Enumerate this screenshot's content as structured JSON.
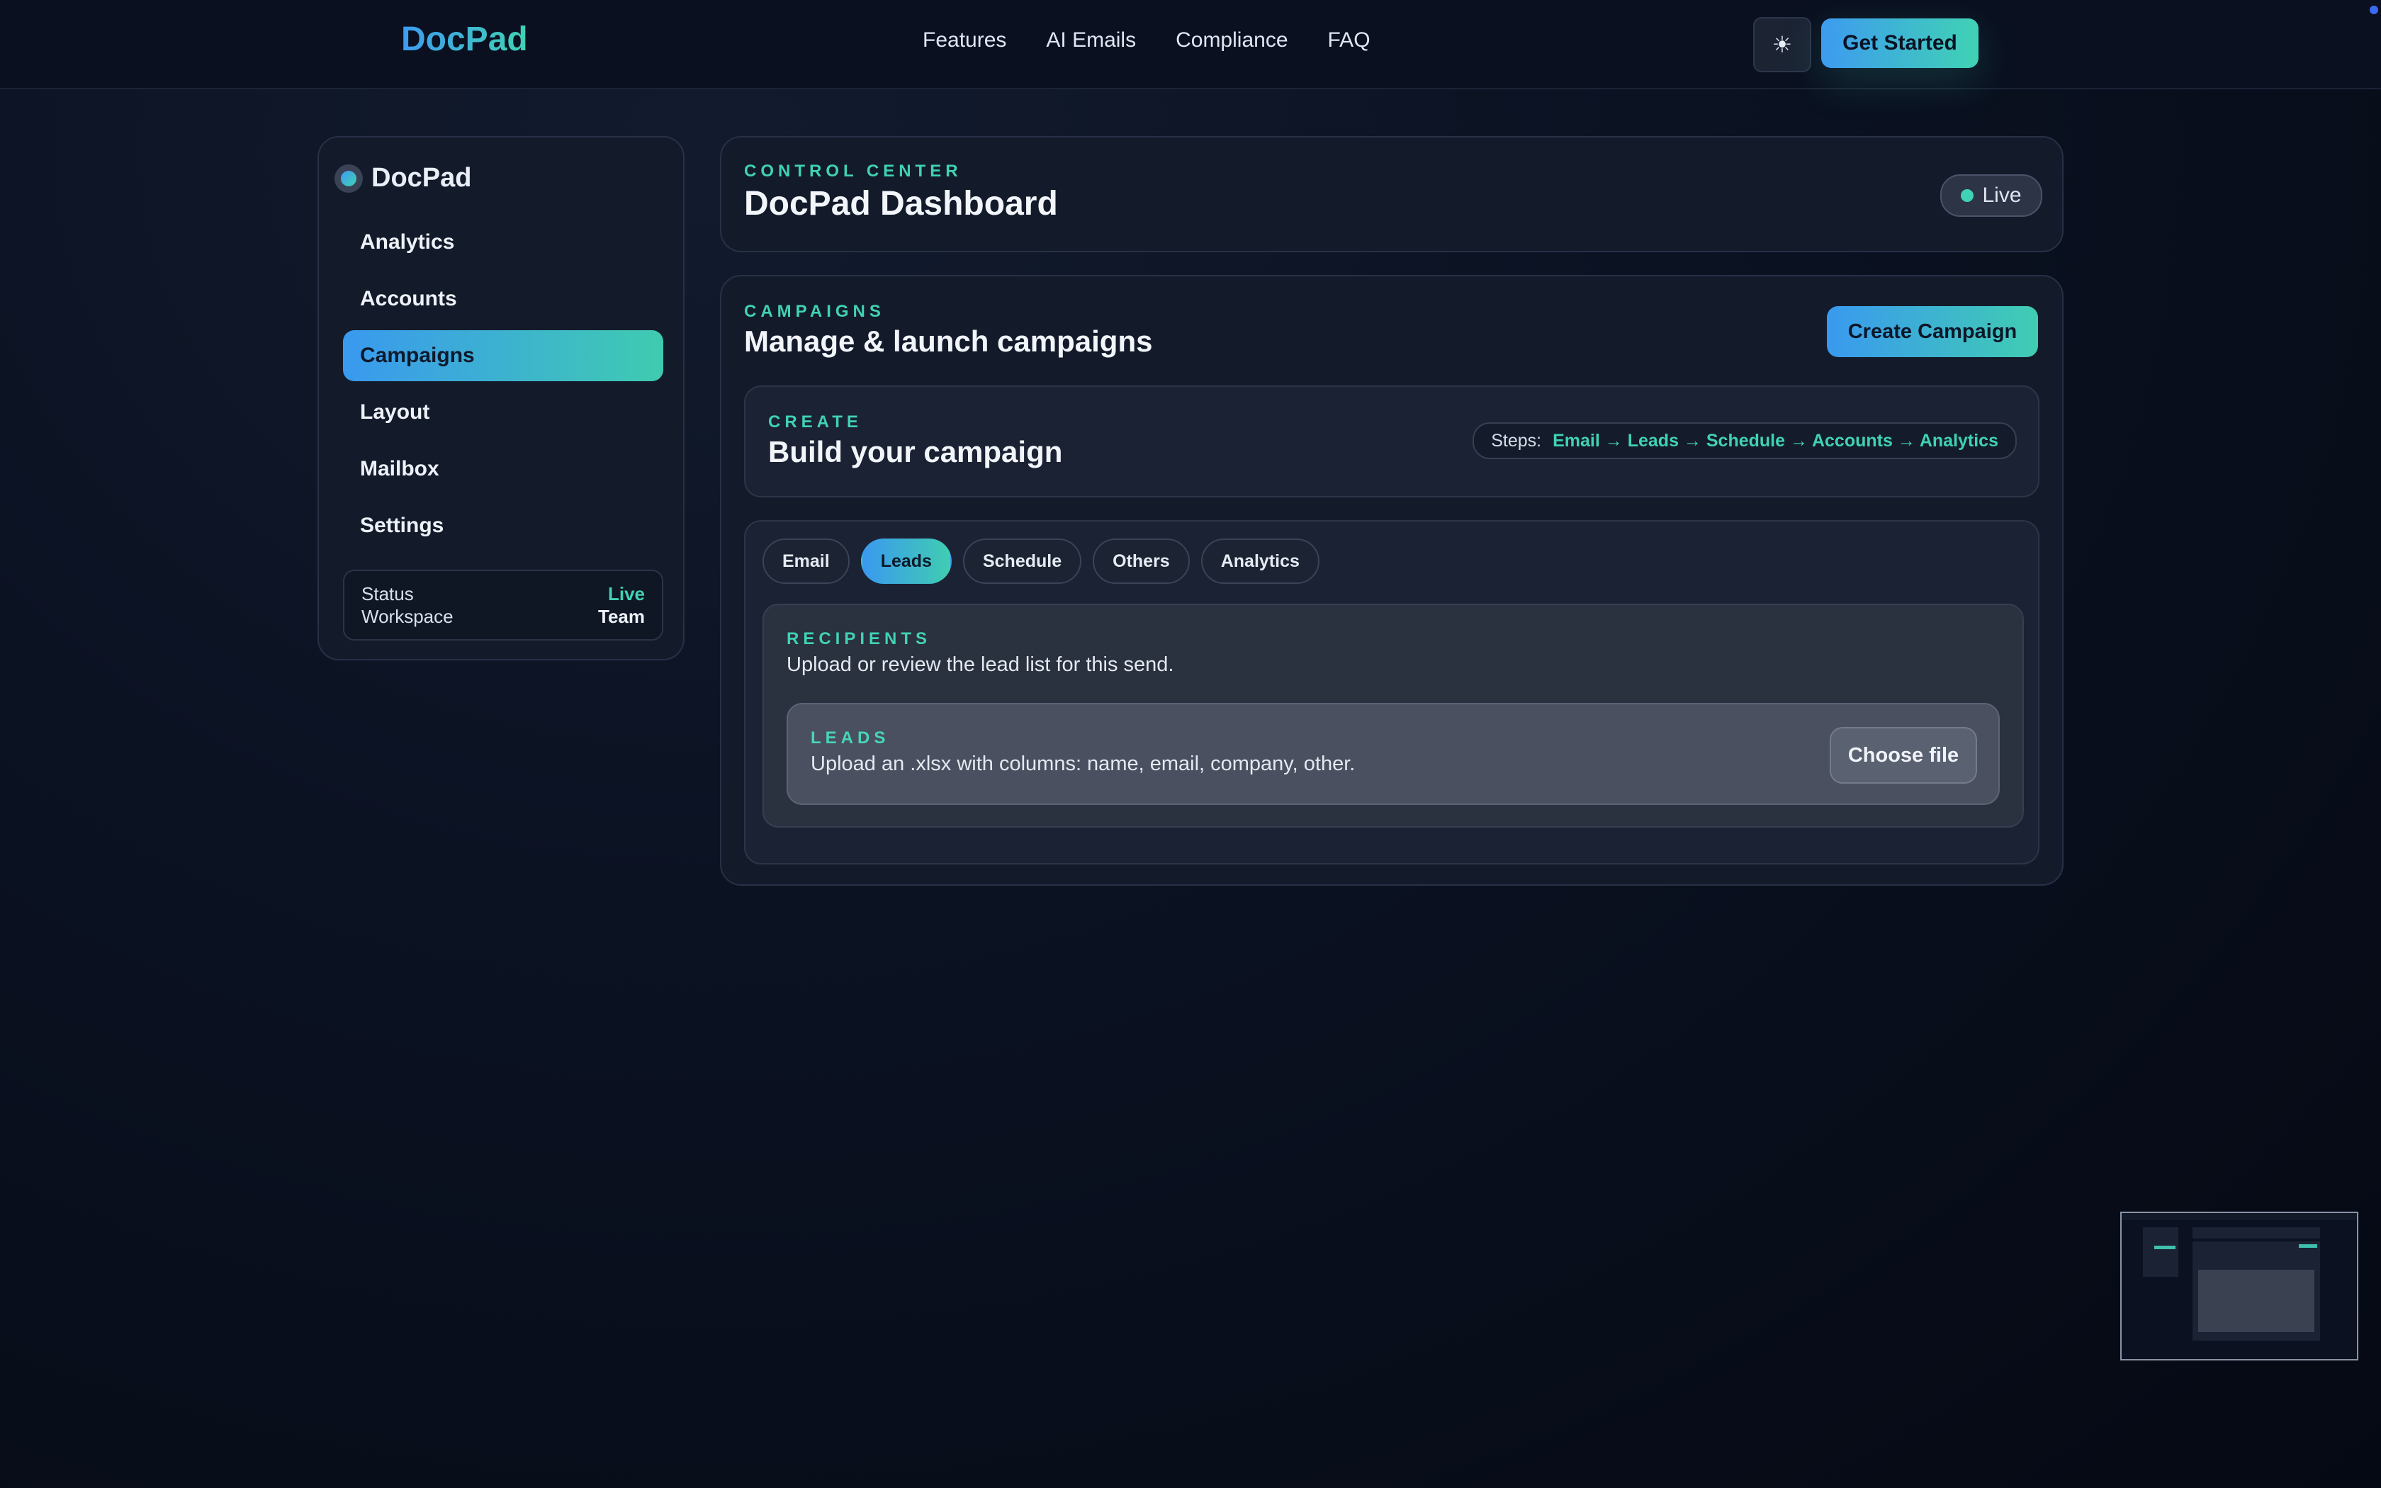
{
  "header": {
    "brand": "DocPad",
    "nav": [
      "Features",
      "AI Emails",
      "Compliance",
      "FAQ"
    ],
    "theme_icon": "sun-icon",
    "cta": "Get Started"
  },
  "sidebar": {
    "brand": "DocPad",
    "items": [
      {
        "label": "Analytics",
        "active": false
      },
      {
        "label": "Accounts",
        "active": false
      },
      {
        "label": "Campaigns",
        "active": true
      },
      {
        "label": "Layout",
        "active": false
      },
      {
        "label": "Mailbox",
        "active": false
      },
      {
        "label": "Settings",
        "active": false
      }
    ],
    "status": {
      "status_label": "Status",
      "status_value": "Live",
      "workspace_label": "Workspace",
      "workspace_value": "Team"
    }
  },
  "dashboard": {
    "eyebrow": "CONTROL CENTER",
    "title": "DocPad Dashboard",
    "live_label": "Live"
  },
  "campaigns": {
    "eyebrow": "CAMPAIGNS",
    "title": "Manage & launch campaigns",
    "create_button": "Create Campaign",
    "create": {
      "eyebrow": "CREATE",
      "title": "Build your campaign",
      "steps_label": "Steps:",
      "steps": "Email → Leads → Schedule → Accounts → Analytics"
    },
    "tabs": [
      {
        "label": "Email",
        "active": false
      },
      {
        "label": "Leads",
        "active": true
      },
      {
        "label": "Schedule",
        "active": false
      },
      {
        "label": "Others",
        "active": false
      },
      {
        "label": "Analytics",
        "active": false
      }
    ],
    "recipients": {
      "eyebrow": "RECIPIENTS",
      "description": "Upload or review the lead list for this send.",
      "leads": {
        "eyebrow": "LEADS",
        "description": "Upload an .xlsx with columns: name, email, company, other.",
        "button": "Choose file"
      }
    }
  },
  "colors": {
    "accent_blue": "#3d9bf0",
    "accent_teal": "#40d2b4",
    "background": "#0b1222"
  }
}
